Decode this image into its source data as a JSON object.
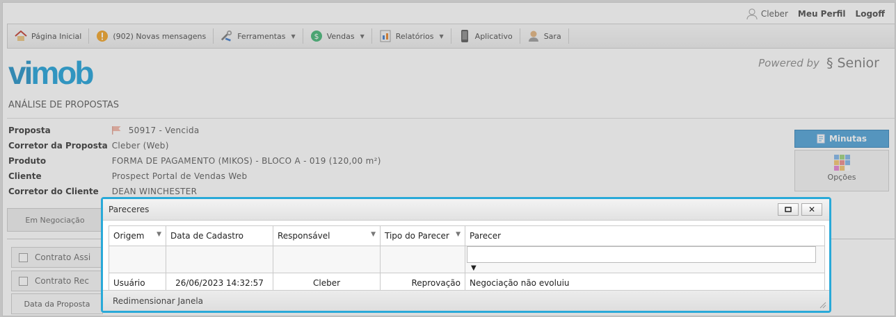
{
  "user_bar": {
    "user": "Cleber",
    "profile": "Meu Perfil",
    "logout": "Logoff"
  },
  "menu": [
    {
      "label": "Página Inicial",
      "icon": "home-icon",
      "dropdown": false
    },
    {
      "label": "(902) Novas mensagens",
      "icon": "alert-icon",
      "dropdown": false
    },
    {
      "label": "Ferramentas",
      "icon": "tools-icon",
      "dropdown": true
    },
    {
      "label": "Vendas",
      "icon": "money-icon",
      "dropdown": true
    },
    {
      "label": "Relatórios",
      "icon": "report-icon",
      "dropdown": true
    },
    {
      "label": "Aplicativo",
      "icon": "phone-icon",
      "dropdown": false
    },
    {
      "label": "Sara",
      "icon": "assistant-icon",
      "dropdown": false
    }
  ],
  "logo": {
    "text_1": "vi",
    "text_2": "mob"
  },
  "powered": {
    "prefix": "Powered by",
    "brand": "Senior"
  },
  "section_title": "ANÁLISE DE PROPOSTAS",
  "info": {
    "rows": [
      {
        "label": "Proposta",
        "value": "50917 - Vencida"
      },
      {
        "label": "Corretor da Proposta",
        "value": "Cleber (Web)"
      },
      {
        "label": "Produto",
        "value": "FORMA DE PAGAMENTO (MIKOS) - BLOCO A - 019 (120,00 m²)"
      },
      {
        "label": "Cliente",
        "value": "Prospect Portal de Vendas Web"
      },
      {
        "label": "Corretor do Cliente",
        "value": "DEAN WINCHESTER"
      }
    ]
  },
  "actions": {
    "minutas": "Minutas",
    "opcoes": "Opções"
  },
  "background_panel": {
    "tab": "Em Negociação",
    "checkbox_1": "Contrato Assi",
    "checkbox_2": "Contrato Rec",
    "date_label": "Data da Proposta"
  },
  "dialog": {
    "title": "Pareceres",
    "columns": [
      {
        "label": "Origem",
        "filter": true
      },
      {
        "label": "Data de Cadastro",
        "filter": false
      },
      {
        "label": "Responsável",
        "filter": true
      },
      {
        "label": "Tipo do Parecer",
        "filter": true
      },
      {
        "label": "Parecer",
        "filter": false
      }
    ],
    "rows": [
      {
        "origem": "Usuário",
        "data": "26/06/2023 14:32:57",
        "responsavel": "Cleber",
        "tipo": "Reprovação",
        "parecer": "Negociação não evoluiu"
      }
    ],
    "parecer_filter_value": "",
    "footer": "Redimensionar Janela"
  },
  "colors": {
    "accent": "#29a9d8",
    "minutas_bg": "#4a9fd6",
    "logo": "#1e8fc6"
  }
}
